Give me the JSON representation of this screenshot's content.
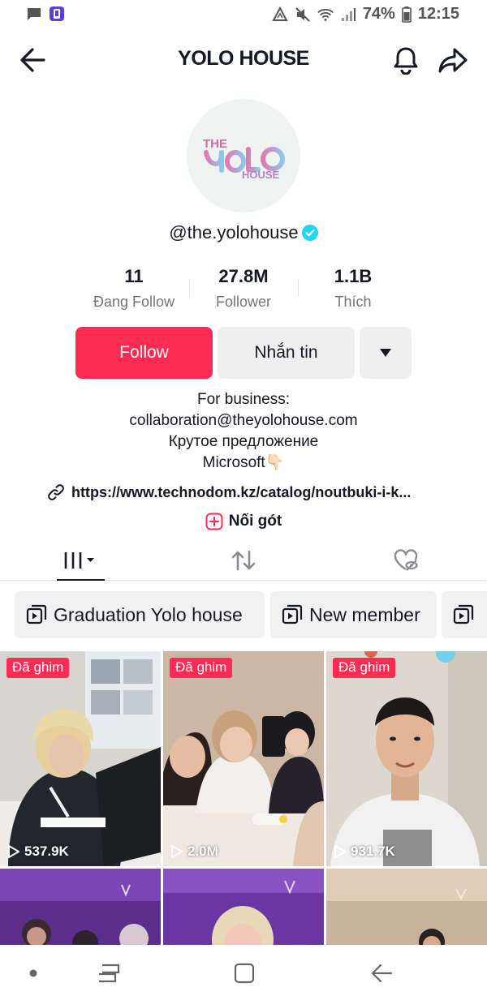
{
  "status_bar": {
    "battery": "74%",
    "time": "12:15"
  },
  "header": {
    "title": "YOLO HOUSE"
  },
  "profile": {
    "avatar_logo": {
      "line1": "THE",
      "line2": "YOLO",
      "line3": "HOUSE"
    },
    "username": "@the.yolohouse",
    "stats": [
      {
        "value": "11",
        "label": "Đang Follow"
      },
      {
        "value": "27.8M",
        "label": "Follower"
      },
      {
        "value": "1.1B",
        "label": "Thích"
      }
    ],
    "follow_label": "Follow",
    "message_label": "Nhắn tin",
    "bio": [
      "For business:",
      "collaboration@theyolohouse.com",
      "Крутое предложение",
      "Microsoft👇🏻"
    ],
    "link": "https://www.technodom.kz/catalog/noutbuki-i-k...",
    "collab_label": "Nối gót"
  },
  "playlists": [
    {
      "label": "Graduation Yolo house"
    },
    {
      "label": "New member"
    },
    {
      "label": ""
    }
  ],
  "videos": [
    {
      "pinned": "Đã ghim",
      "views": "537.9K"
    },
    {
      "pinned": "Đã ghim",
      "views": "2.0M"
    },
    {
      "pinned": "Đã ghim",
      "views": "931.7K"
    }
  ],
  "colors": {
    "accent": "#fe2c55",
    "verified": "#20d5ec"
  }
}
